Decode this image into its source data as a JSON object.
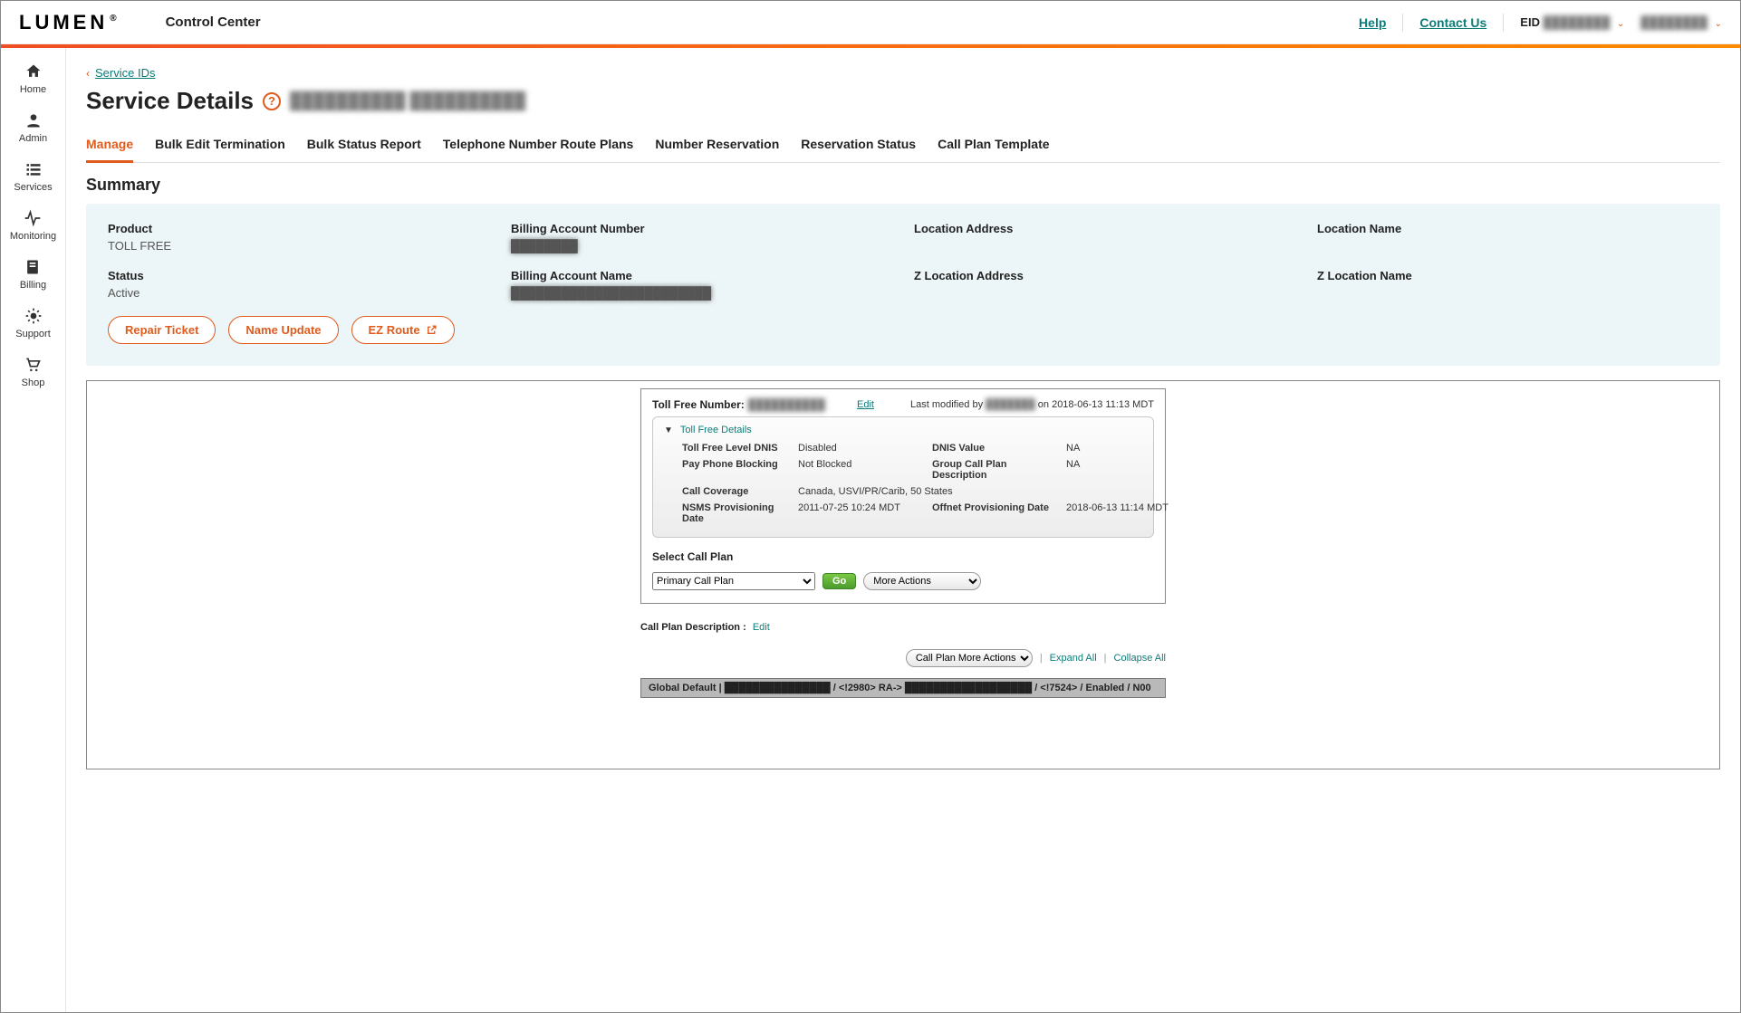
{
  "topbar": {
    "logo": "LUMEN",
    "app_title": "Control Center",
    "help": "Help",
    "contact": "Contact Us",
    "eid_label": "EID",
    "eid_value": "████████",
    "right_value": "████████"
  },
  "sidebar": {
    "items": [
      {
        "label": "Home"
      },
      {
        "label": "Admin"
      },
      {
        "label": "Services"
      },
      {
        "label": "Monitoring"
      },
      {
        "label": "Billing"
      },
      {
        "label": "Support"
      },
      {
        "label": "Shop"
      }
    ]
  },
  "breadcrumb": {
    "back": "Service IDs"
  },
  "page_title": "Service Details",
  "page_title_sub": "██████████  ██████████",
  "tabs": [
    {
      "label": "Manage",
      "active": true
    },
    {
      "label": "Bulk Edit Termination"
    },
    {
      "label": "Bulk Status Report"
    },
    {
      "label": "Telephone Number Route Plans"
    },
    {
      "label": "Number Reservation"
    },
    {
      "label": "Reservation Status"
    },
    {
      "label": "Call Plan Template"
    }
  ],
  "summary": {
    "heading": "Summary",
    "fields": [
      {
        "label": "Product",
        "value": "TOLL FREE"
      },
      {
        "label": "Billing Account Number",
        "value": "████████"
      },
      {
        "label": "Location Address",
        "value": ""
      },
      {
        "label": "Location Name",
        "value": ""
      },
      {
        "label": "Status",
        "value": "Active"
      },
      {
        "label": "Billing Account Name",
        "value": "████████████████████████"
      },
      {
        "label": "Z Location Address",
        "value": ""
      },
      {
        "label": "Z Location Name",
        "value": ""
      }
    ],
    "buttons": {
      "repair": "Repair Ticket",
      "name_update": "Name Update",
      "ez_route": "EZ Route"
    }
  },
  "toll": {
    "number_label": "Toll Free Number:",
    "number_value": "██████████",
    "edit": "Edit",
    "modified_prefix": "Last modified by",
    "modified_user": "███████",
    "modified_suffix": "on 2018-06-13 11:13 MDT",
    "details_title": "Toll Free Details",
    "rows": [
      {
        "k1": "Toll Free Level DNIS",
        "v1": "Disabled",
        "k2": "DNIS Value",
        "v2": "NA"
      },
      {
        "k1": "Pay Phone Blocking",
        "v1": "Not Blocked",
        "k2": "Group Call Plan Description",
        "v2": "NA"
      },
      {
        "k1": "Call Coverage",
        "v1": "Canada, USVI/PR/Carib, 50 States",
        "k2": "",
        "v2": ""
      },
      {
        "k1": "NSMS Provisioning Date",
        "v1": "2011-07-25 10:24 MDT",
        "k2": "Offnet Provisioning Date",
        "v2": "2018-06-13 11:14 MDT"
      }
    ],
    "select_label": "Select Call Plan",
    "plan_selected": "Primary Call Plan",
    "go": "Go",
    "more_actions": "More Actions"
  },
  "below": {
    "cpd_label": "Call Plan Description :",
    "cpd_edit": "Edit",
    "cpma": "Call Plan More Actions",
    "expand": "Expand All",
    "collapse": "Collapse All",
    "global_row": "Global Default | ███████████████ / <!2980> RA-> ██████████████████ / <!7524> / Enabled / N00"
  }
}
